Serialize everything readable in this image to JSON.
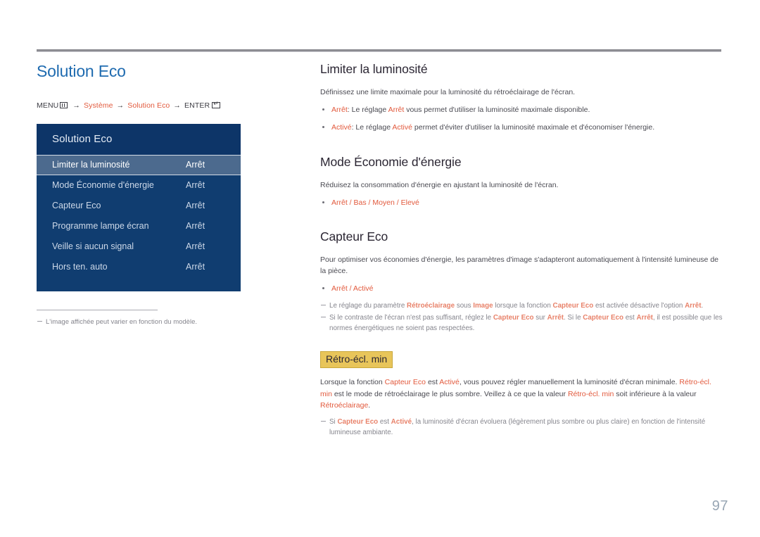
{
  "document": {
    "page_number": "97"
  },
  "left": {
    "page_title": "Solution Eco",
    "breadcrumb": {
      "menu_label": "MENU",
      "menu_icon": "menu-bars-icon",
      "arrow": "→",
      "step1": "Système",
      "step2": "Solution Eco",
      "enter_label": "ENTER",
      "enter_icon": "enter-key-icon"
    },
    "osd": {
      "header": "Solution Eco",
      "rows": [
        {
          "label": "Limiter la luminosité",
          "value": "Arrêt",
          "selected": true
        },
        {
          "label": "Mode Économie d'énergie",
          "value": "Arrêt",
          "selected": false
        },
        {
          "label": "Capteur Eco",
          "value": "Arrêt",
          "selected": false
        },
        {
          "label": "Programme lampe écran",
          "value": "Arrêt",
          "selected": false
        },
        {
          "label": "Veille si aucun signal",
          "value": "Arrêt",
          "selected": false
        },
        {
          "label": "Hors ten. auto",
          "value": "Arrêt",
          "selected": false
        }
      ]
    },
    "footnote": "L'image affichée peut varier en fonction du modèle."
  },
  "right": {
    "section1": {
      "heading": "Limiter la luminosité",
      "intro": "Définissez une limite maximale pour la luminosité du rétroéclairage de l'écran.",
      "bullet1": {
        "term": "Arrêt",
        "text_a": ": Le réglage ",
        "term2": "Arrêt",
        "text_b": " vous permet d'utiliser la luminosité maximale disponible."
      },
      "bullet2": {
        "term": "Activé",
        "text_a": ": Le réglage ",
        "term2": "Activé",
        "text_b": " permet d'éviter d'utiliser la luminosité maximale et d'économiser l'énergie."
      }
    },
    "section2": {
      "heading": "Mode Économie d'énergie",
      "intro": "Réduisez la consommation d'énergie en ajustant la luminosité de l'écran.",
      "options": "Arrêt / Bas / Moyen / Elevé"
    },
    "section3": {
      "heading": "Capteur Eco",
      "intro": "Pour optimiser vos économies d'énergie, les paramètres d'image s'adapteront automatiquement à l'intensité lumineuse de la pièce.",
      "options": "Arrêt / Activé",
      "note1": {
        "t1": "Le réglage du paramètre ",
        "a1": "Rétroéclairage",
        "t2": " sous ",
        "a2": "Image",
        "t3": " lorsque la fonction ",
        "a3": "Capteur Eco",
        "t4": " est activée désactive l'option ",
        "a4": "Arrêt",
        "t5": "."
      },
      "note2": {
        "t1": "Si le contraste de l'écran n'est pas suffisant, réglez le ",
        "a1": "Capteur Eco",
        "t2": " sur ",
        "a2": "Arrêt",
        "t3": ". Si le ",
        "a3": "Capteur Eco",
        "t4": " est ",
        "a4": "Arrêt",
        "t5": ", il est possible que les normes énergétiques ne soient pas respectées."
      }
    },
    "section4": {
      "heading": "Rétro-écl. min",
      "heading_highlight_color": "#e8c55a",
      "para": {
        "t1": "Lorsque la fonction ",
        "a1": "Capteur Eco",
        "t2": " est ",
        "a2": "Activé",
        "t3": ", vous pouvez régler manuellement la luminosité d'écran minimale. ",
        "a3": "Rétro-écl. min",
        "t4": " est le mode de rétroéclairage le plus sombre. Veillez à ce que la valeur ",
        "a4": "Rétro-écl. min",
        "t5": " soit inférieure à la valeur ",
        "a5": "Rétroéclairage",
        "t6": "."
      },
      "note1": {
        "t1": "Si ",
        "a1": "Capteur Eco",
        "t2": " est ",
        "a2": "Activé",
        "t3": ", la luminosité d'écran évoluera (légèrement plus sombre ou plus claire) en fonction de l'intensité lumineuse ambiante."
      }
    }
  },
  "colors": {
    "accent_red": "#e2593c",
    "title_blue": "#1f6bb0",
    "osd_blue": "#103d70",
    "osd_selected": "#4c6a8e",
    "highlight_yellow": "#e8c55a",
    "page_number": "#98a6b4"
  }
}
